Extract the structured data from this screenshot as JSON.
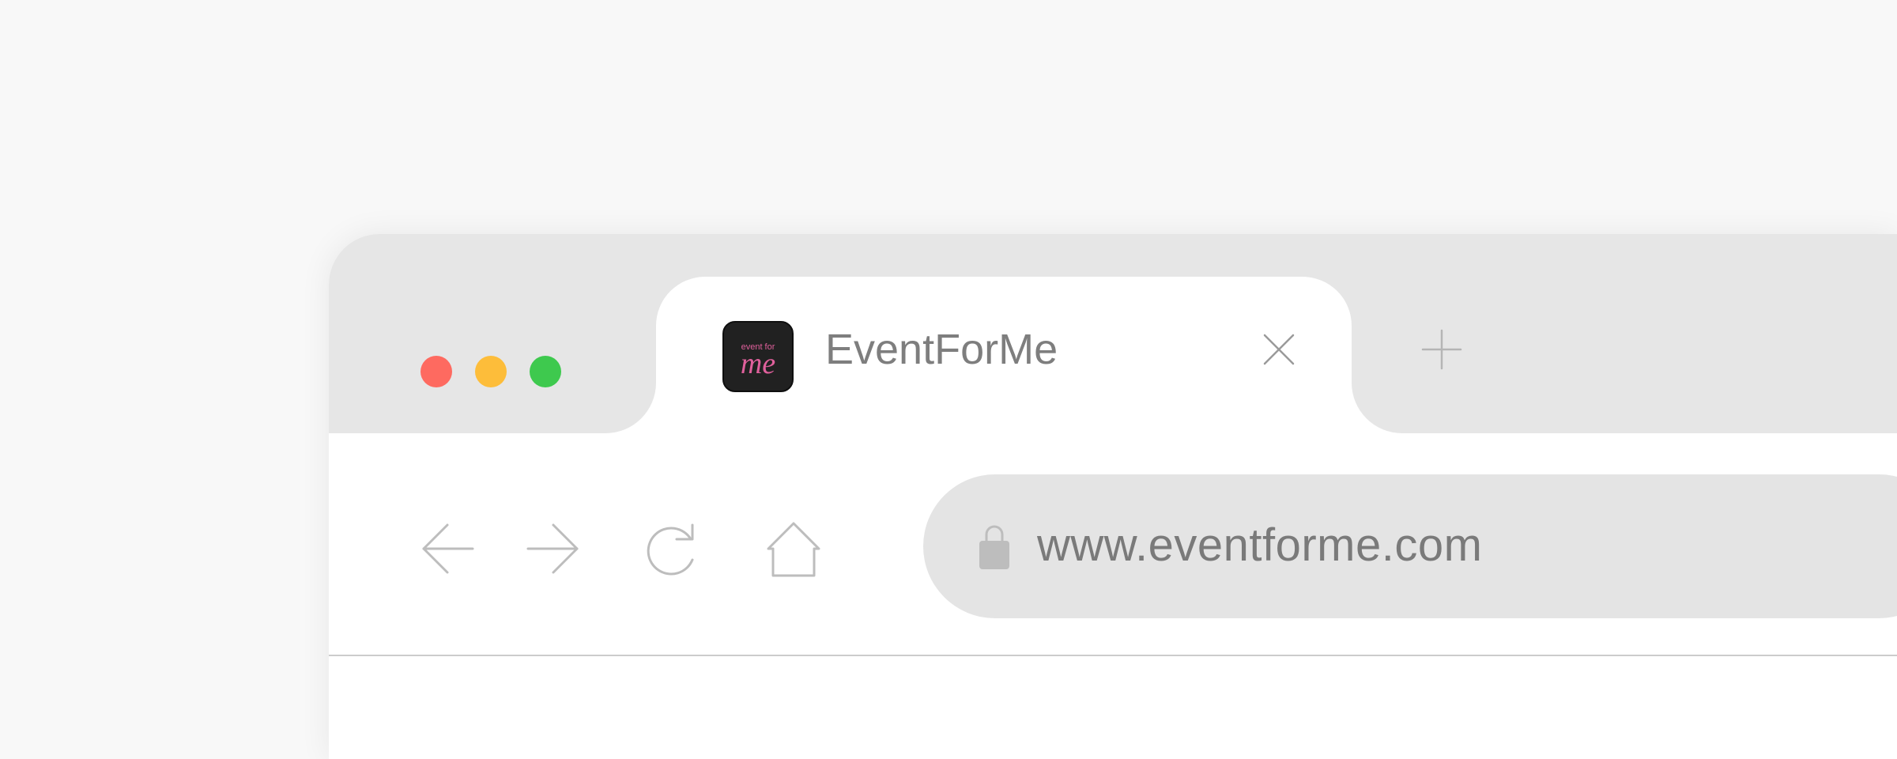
{
  "window": {
    "controls": {
      "close": {
        "color": "#fe6a60"
      },
      "minimize": {
        "color": "#fdbd3a"
      },
      "zoom": {
        "color": "#3ec94e"
      }
    }
  },
  "tab": {
    "title": "EventForMe",
    "favicon": {
      "text_top": "event for",
      "text_main": "me",
      "accent": "#e0609c",
      "background": "#212121"
    },
    "close_icon": "close-icon"
  },
  "tabstrip": {
    "new_tab_icon": "plus-icon",
    "background": "#e6e6e6"
  },
  "toolbar": {
    "buttons": [
      {
        "name": "back",
        "icon": "arrow-left-icon"
      },
      {
        "name": "forward",
        "icon": "arrow-right-icon"
      },
      {
        "name": "reload",
        "icon": "reload-icon"
      },
      {
        "name": "home",
        "icon": "home-icon"
      }
    ],
    "icon_color": "#bdbdbd"
  },
  "address_bar": {
    "url": "www.eventforme.com",
    "lock_icon": "lock-icon",
    "background": "#e4e4e4"
  }
}
